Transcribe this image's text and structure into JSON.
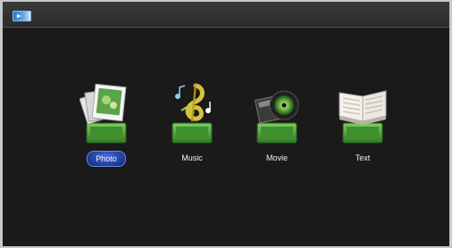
{
  "menu": {
    "items": [
      {
        "label": "Photo",
        "icon": "photo-icon",
        "selected": true
      },
      {
        "label": "Music",
        "icon": "music-icon",
        "selected": false
      },
      {
        "label": "Movie",
        "icon": "movie-icon",
        "selected": false
      },
      {
        "label": "Text",
        "icon": "text-icon",
        "selected": false
      }
    ]
  },
  "colors": {
    "background": "#1a1a1a",
    "topbar": "#2f2f2f",
    "stand_green": "#4fa63a",
    "selection": "#2448b0"
  }
}
